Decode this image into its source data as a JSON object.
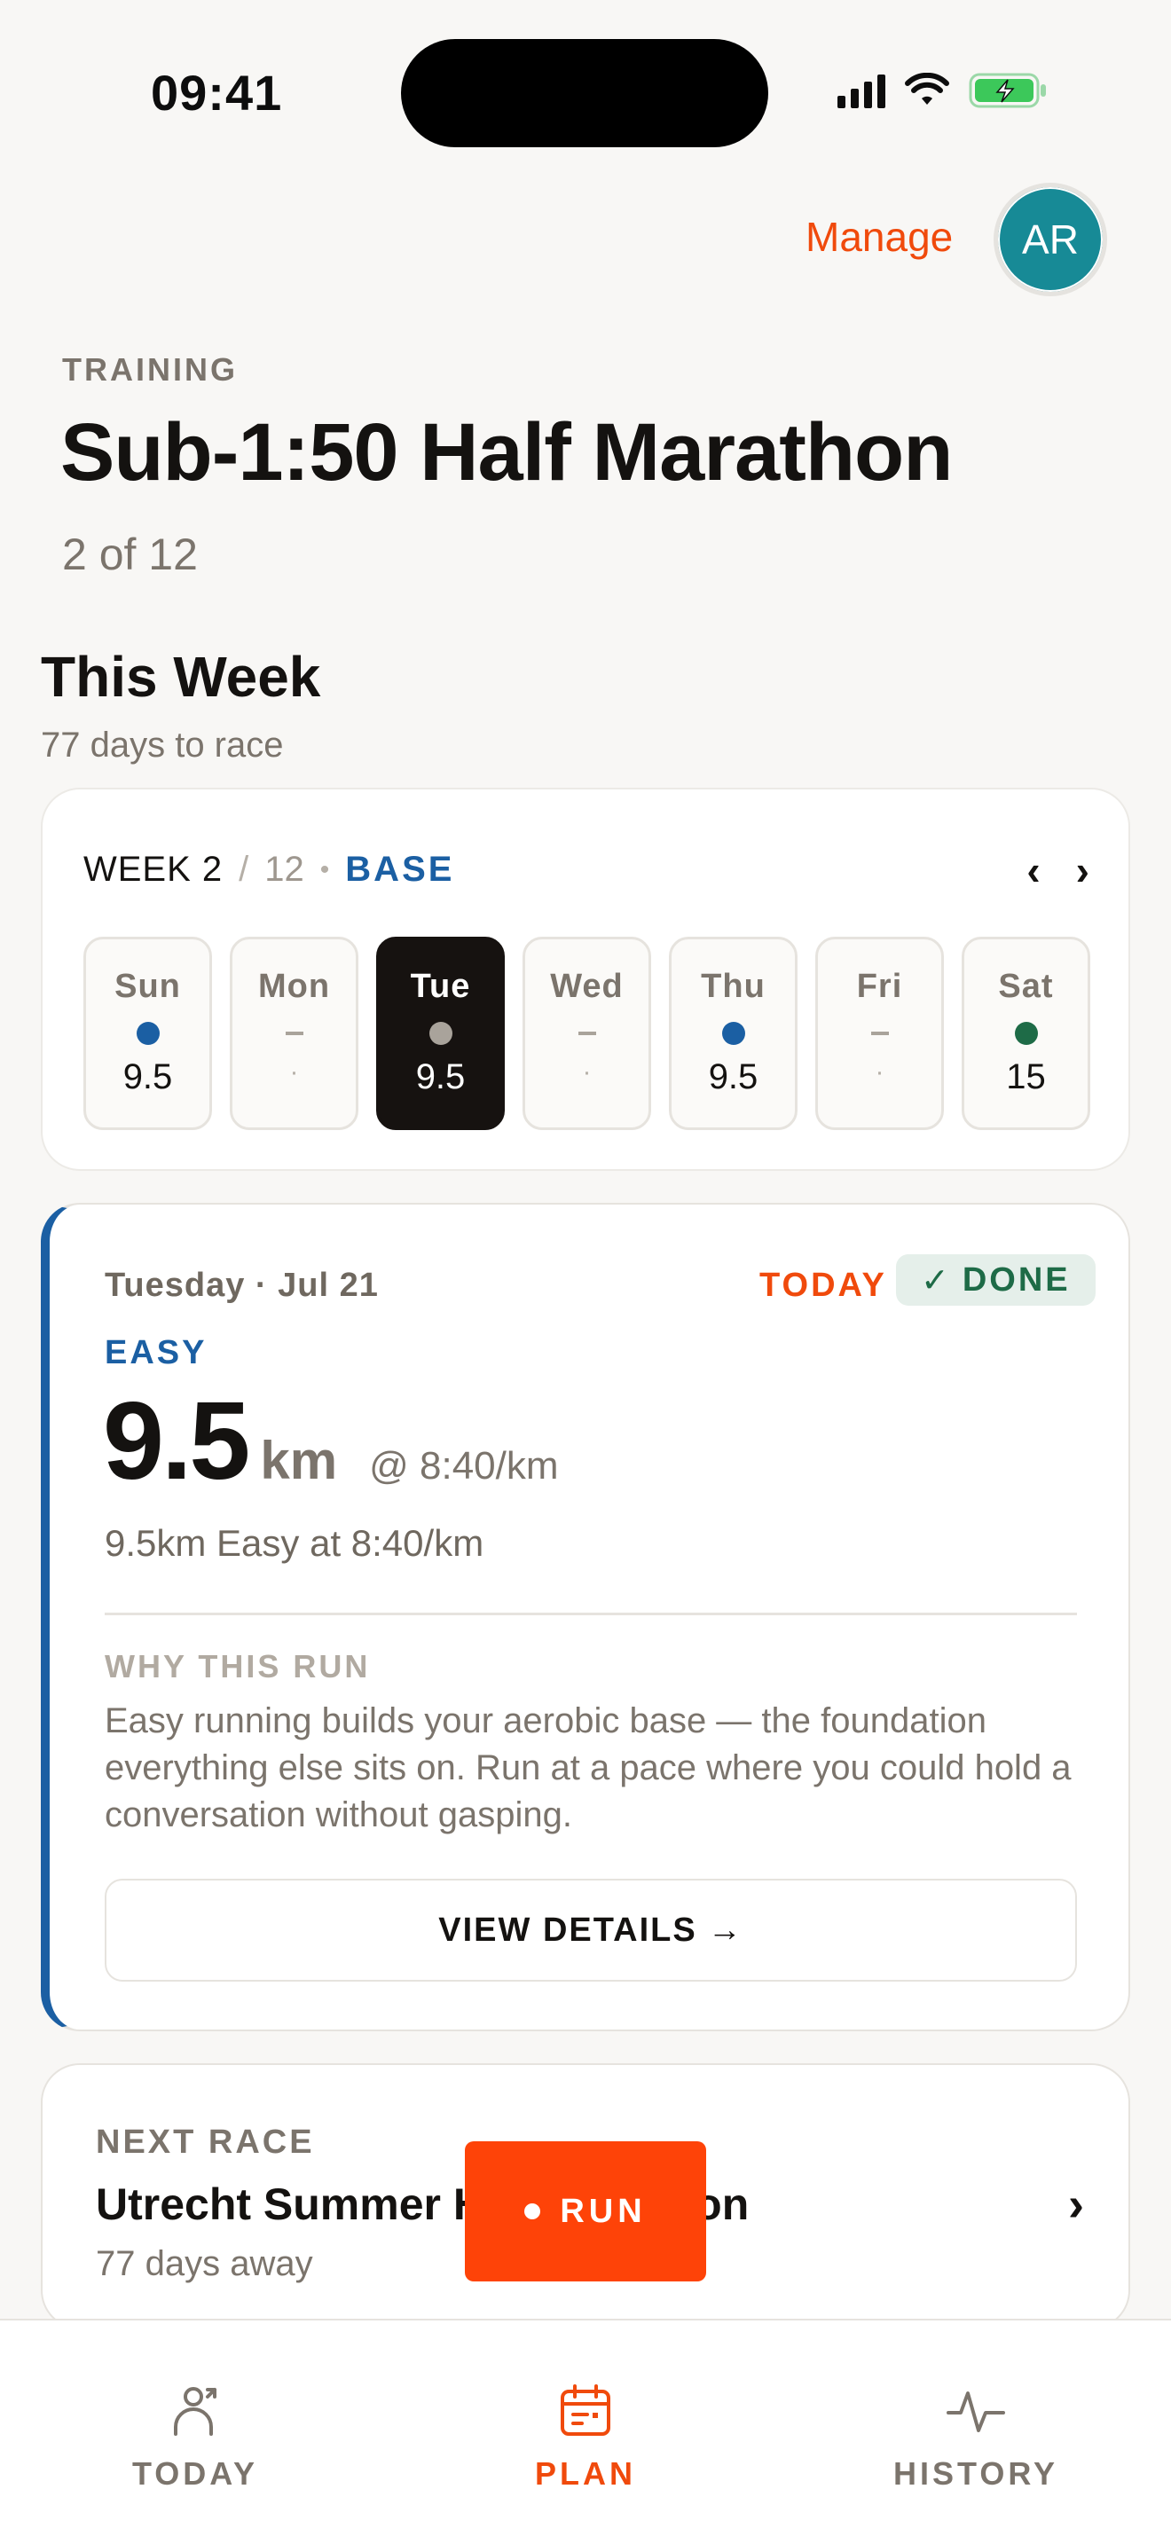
{
  "status_bar": {
    "time": "09:41"
  },
  "header": {
    "manage_label": "Manage",
    "avatar_initials": "AR"
  },
  "plan": {
    "eyebrow": "TRAINING",
    "title": "Sub-1:50 Half Marathon",
    "progress": "2 of 12"
  },
  "this_week": {
    "title": "This Week",
    "subtitle": "77 days to race",
    "week_label": "WEEK 2",
    "separator": "/",
    "week_total": "12",
    "dot": "•",
    "phase": "BASE",
    "prev": "‹",
    "next": "›",
    "days": [
      {
        "name": "Sun",
        "value": "9.5",
        "marker": "dot",
        "color": "#1B5FA3"
      },
      {
        "name": "Mon",
        "value": "·",
        "marker": "dash",
        "color": "#A9A39B"
      },
      {
        "name": "Tue",
        "value": "9.5",
        "marker": "dot",
        "color": "#A9A39B",
        "selected": true
      },
      {
        "name": "Wed",
        "value": "·",
        "marker": "dash",
        "color": "#A9A39B"
      },
      {
        "name": "Thu",
        "value": "9.5",
        "marker": "dot",
        "color": "#1B5FA3"
      },
      {
        "name": "Fri",
        "value": "·",
        "marker": "dash",
        "color": "#A9A39B"
      },
      {
        "name": "Sat",
        "value": "15",
        "marker": "dot",
        "color": "#1E6B47"
      }
    ]
  },
  "workout": {
    "date": "Tuesday · Jul 21",
    "today_label": "TODAY",
    "done_check": "✓",
    "done_label": "DONE",
    "type": "EASY",
    "distance": "9.5",
    "unit": "km",
    "pace": "@ 8:40/km",
    "description": "9.5km Easy at 8:40/km",
    "why_label": "WHY THIS RUN",
    "why_text": "Easy running builds your aerobic base — the foundation everything else sits on. Run at a pace where you could hold a conversation without gasping.",
    "view_details": "VIEW DETAILS",
    "view_arrow": "→"
  },
  "next_race": {
    "label": "NEXT RACE",
    "name": "Utrecht Summer Half Marathon",
    "days_away": "77 days away",
    "chevron": "›"
  },
  "run_button": {
    "label": "RUN"
  },
  "tabs": [
    {
      "label": "TODAY",
      "icon": "runner-icon",
      "active": false
    },
    {
      "label": "PLAN",
      "icon": "calendar-icon",
      "active": true
    },
    {
      "label": "HISTORY",
      "icon": "activity-icon",
      "active": false
    }
  ],
  "colors": {
    "accent": "#F04A0C",
    "run_button": "#FE4308",
    "easy_blue": "#1B5FA3",
    "done_green": "#1E6B47",
    "avatar": "#178A96"
  }
}
